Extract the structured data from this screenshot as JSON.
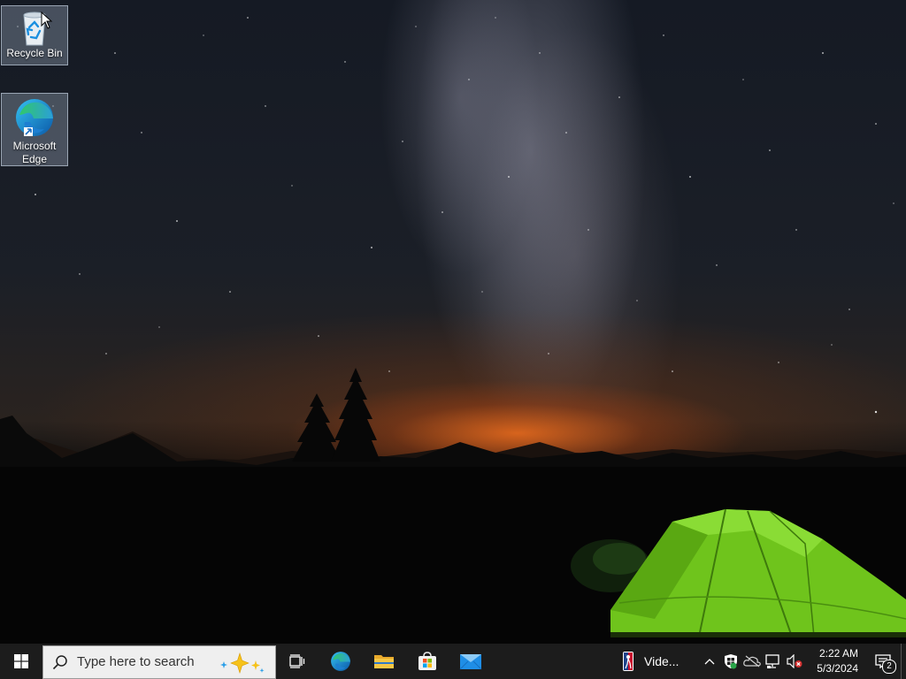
{
  "desktop": {
    "wallpaper": "Starry night sky with the Milky Way over mountain silhouettes and a glowing green tent",
    "icons": [
      {
        "label": "Recycle Bin",
        "icon": "recycle-bin-icon"
      },
      {
        "label": "Microsoft Edge",
        "icon": "edge-icon"
      }
    ]
  },
  "taskbar": {
    "start": {
      "icon": "windows-logo-icon"
    },
    "search": {
      "placeholder": "Type here to search",
      "icon": "search-icon",
      "highlight_icon": "sparkle-icon"
    },
    "task_view": {
      "icon": "task-view-icon"
    },
    "apps": [
      {
        "name": "Microsoft Edge",
        "icon": "edge-icon"
      },
      {
        "name": "File Explorer",
        "icon": "folder-icon"
      },
      {
        "name": "Microsoft Store",
        "icon": "store-icon"
      },
      {
        "name": "Mail",
        "icon": "mail-icon"
      }
    ],
    "news_widget": {
      "icon": "nba-logo-icon",
      "text": "Vide..."
    },
    "tray": {
      "icons": [
        "chevron-up-icon",
        "windows-security-icon",
        "onedrive-offline-icon",
        "network-icon",
        "volume-muted-icon"
      ]
    },
    "clock": {
      "time": "2:22 AM",
      "date": "5/3/2024"
    },
    "notifications": {
      "icon": "notification-icon",
      "count": "2"
    }
  },
  "colors": {
    "taskbar": "#1c1c1c",
    "search_box": "#efefef",
    "accent_blue": "#0078d4",
    "tent_green": "#7dd321"
  }
}
